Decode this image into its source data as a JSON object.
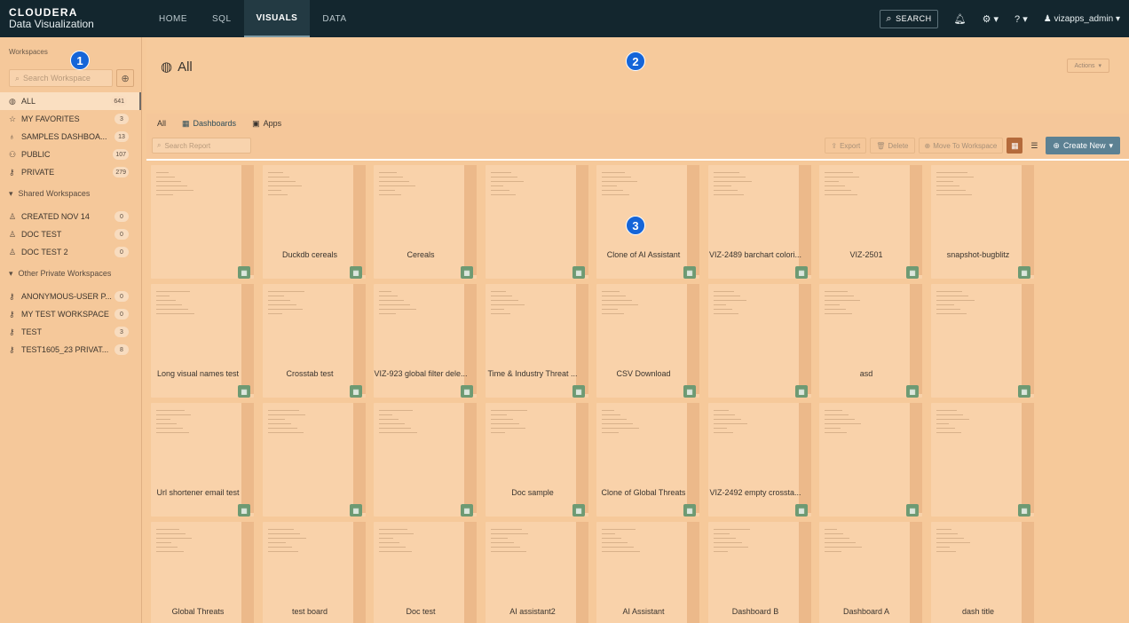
{
  "brand": {
    "line1": "CLOUDERA",
    "line2": "Data Visualization"
  },
  "nav": [
    {
      "label": "HOME",
      "active": false
    },
    {
      "label": "SQL",
      "active": false
    },
    {
      "label": "VISUALS",
      "active": true
    },
    {
      "label": "DATA",
      "active": false
    }
  ],
  "topbar": {
    "search_label": "SEARCH",
    "user": "vizapps_admin"
  },
  "sidebar": {
    "title": "Workspaces",
    "search_placeholder": "Search Workspace",
    "items": [
      {
        "icon": "globe-icon",
        "glyph": "◍",
        "label": "ALL",
        "count": "641",
        "active": true
      },
      {
        "icon": "star-icon",
        "glyph": "☆",
        "label": "MY FAVORITES",
        "count": "3"
      },
      {
        "icon": "bulb-icon",
        "glyph": "♁",
        "label": "SAMPLES DASHBOA...",
        "count": "13"
      },
      {
        "icon": "people-icon",
        "glyph": "⚇",
        "label": "PUBLIC",
        "count": "107"
      },
      {
        "icon": "key-icon",
        "glyph": "⚷",
        "label": "PRIVATE",
        "count": "279"
      }
    ],
    "shared_header": "Shared Workspaces",
    "shared_items": [
      {
        "icon": "user-icon",
        "glyph": "♙",
        "label": "CREATED NOV 14",
        "count": "0"
      },
      {
        "icon": "user-icon",
        "glyph": "♙",
        "label": "DOC TEST",
        "count": "0"
      },
      {
        "icon": "user-icon",
        "glyph": "♙",
        "label": "DOC TEST 2",
        "count": "0"
      }
    ],
    "other_header": "Other Private Workspaces",
    "other_items": [
      {
        "icon": "key-icon",
        "glyph": "⚷",
        "label": "ANONYMOUS-USER P...",
        "count": "0"
      },
      {
        "icon": "key-icon",
        "glyph": "⚷",
        "label": "MY TEST WORKSPACE",
        "count": "0"
      },
      {
        "icon": "key-icon",
        "glyph": "⚷",
        "label": "TEST",
        "count": "3"
      },
      {
        "icon": "key-icon",
        "glyph": "⚷",
        "label": "TEST1605_23 PRIVAT...",
        "count": "8"
      }
    ]
  },
  "main": {
    "title": "All",
    "actions_label": "Actions",
    "tabs": [
      {
        "label": "All",
        "icon": "",
        "active": false
      },
      {
        "label": "Dashboards",
        "icon": "▦",
        "active": true
      },
      {
        "label": "Apps",
        "icon": "▣",
        "active": false
      }
    ],
    "report_search_placeholder": "Search Report",
    "toolbar": {
      "export": "Export",
      "delete": "Delete",
      "move": "Move To Workspace",
      "create": "Create New"
    }
  },
  "cards": [
    "",
    "Duckdb cereals",
    "Cereals",
    "",
    "Clone of AI Assistant",
    "VIZ-2489 barchart colori...",
    "VIZ-2501",
    "snapshot-bugblitz",
    "Long visual names test",
    "Crosstab test",
    "VIZ-923 global filter dele...",
    "Time & Industry Threat ...",
    "CSV Download",
    "",
    "asd",
    "",
    "Url shortener email test",
    "",
    "",
    "Doc sample",
    "Clone of Global Threats",
    "VIZ-2492 empty crossta...",
    "",
    "",
    "Global Threats",
    "test board",
    "Doc test",
    "AI assistant2",
    "AI Assistant",
    "Dashboard B",
    "Dashboard A",
    "dash title"
  ],
  "markers": [
    "1",
    "2",
    "3"
  ]
}
